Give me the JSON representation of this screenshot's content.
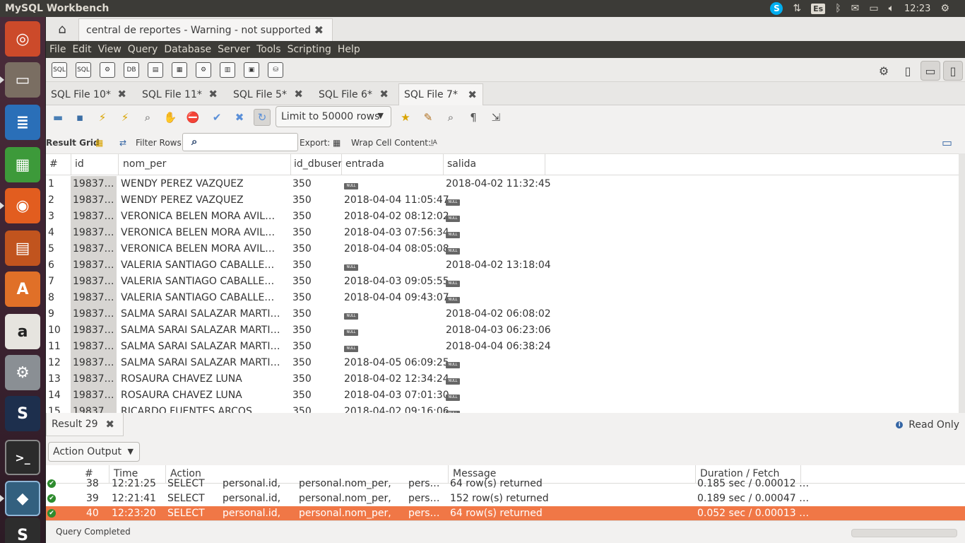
{
  "app": {
    "title": "MySQL Workbench"
  },
  "tray": {
    "skype": "S",
    "lang": "Es",
    "time": "12:23"
  },
  "launcher": {
    "items": [
      {
        "name": "ubuntu-dash-icon",
        "color": "#cc4a2a",
        "glyph": "◎"
      },
      {
        "name": "files-icon",
        "color": "#7a6e62",
        "glyph": "▭"
      },
      {
        "name": "writer-icon",
        "color": "#2a6fb8",
        "glyph": "≣"
      },
      {
        "name": "calc-icon",
        "color": "#3d9a3a",
        "glyph": "▦"
      },
      {
        "name": "firefox-icon",
        "color": "#e25d1f",
        "glyph": "◉"
      },
      {
        "name": "impress-icon",
        "color": "#c1541e",
        "glyph": "▤"
      },
      {
        "name": "software-center-icon",
        "color": "#e07028",
        "glyph": "A"
      },
      {
        "name": "amazon-icon",
        "color": "#e6e4df",
        "glyph": "a"
      },
      {
        "name": "settings-icon",
        "color": "#8a8f94",
        "glyph": "⚙"
      },
      {
        "name": "app-s-icon",
        "color": "#1d2f4d",
        "glyph": "S"
      },
      {
        "name": "terminal-icon",
        "color": "#2b2b2b",
        "glyph": ">_"
      },
      {
        "name": "mysql-workbench-icon",
        "color": "#33607f",
        "glyph": "◆"
      },
      {
        "name": "sublime-icon",
        "color": "#2d2d2d",
        "glyph": "S"
      }
    ]
  },
  "connection_tab": {
    "label": "central de reportes - Warning - not supported"
  },
  "menu": [
    "File",
    "Edit",
    "View",
    "Query",
    "Database",
    "Server",
    "Tools",
    "Scripting",
    "Help"
  ],
  "main_toolbar": {
    "icons": [
      "SQL",
      "SQL",
      "⚙",
      "DB",
      "▤",
      "▦",
      "⚙",
      "▥",
      "▣",
      "⛁"
    ]
  },
  "file_tabs": [
    {
      "label": "SQL File 10*",
      "active": false
    },
    {
      "label": "SQL File 11*",
      "active": false
    },
    {
      "label": "SQL File 5*",
      "active": false
    },
    {
      "label": "SQL File 6*",
      "active": false
    },
    {
      "label": "SQL File 7*",
      "active": true
    }
  ],
  "sql_toolbar": {
    "limit_label": "Limit to 50000 rows"
  },
  "result_bar": {
    "result_grid_label": "Result Grid",
    "filter_label": "Filter Rows:",
    "export_label": "Export:",
    "wrap_label": "Wrap Cell Content:"
  },
  "grid": {
    "columns": [
      "#",
      "id",
      "nom_per",
      "id_dbuser",
      "entrada",
      "salida"
    ],
    "rows": [
      {
        "n": "1",
        "id": "19837…",
        "nom": "WENDY PEREZ VAZQUEZ",
        "db": "350",
        "entrada": null,
        "salida": "2018-04-02 11:32:45"
      },
      {
        "n": "2",
        "id": "19837…",
        "nom": "WENDY PEREZ VAZQUEZ",
        "db": "350",
        "entrada": "2018-04-04 11:05:47",
        "salida": null
      },
      {
        "n": "3",
        "id": "19837…",
        "nom": "VERONICA BELEN MORA AVIL…",
        "db": "350",
        "entrada": "2018-04-02 08:12:02",
        "salida": null
      },
      {
        "n": "4",
        "id": "19837…",
        "nom": "VERONICA BELEN MORA AVIL…",
        "db": "350",
        "entrada": "2018-04-03 07:56:34",
        "salida": null
      },
      {
        "n": "5",
        "id": "19837…",
        "nom": "VERONICA BELEN MORA AVIL…",
        "db": "350",
        "entrada": "2018-04-04 08:05:08",
        "salida": null
      },
      {
        "n": "6",
        "id": "19837…",
        "nom": "VALERIA SANTIAGO CABALLE…",
        "db": "350",
        "entrada": null,
        "salida": "2018-04-02 13:18:04"
      },
      {
        "n": "7",
        "id": "19837…",
        "nom": "VALERIA SANTIAGO CABALLE…",
        "db": "350",
        "entrada": "2018-04-03 09:05:55",
        "salida": null
      },
      {
        "n": "8",
        "id": "19837…",
        "nom": "VALERIA SANTIAGO CABALLE…",
        "db": "350",
        "entrada": "2018-04-04 09:43:07",
        "salida": null
      },
      {
        "n": "9",
        "id": "19837…",
        "nom": "SALMA SARAI SALAZAR MARTI…",
        "db": "350",
        "entrada": null,
        "salida": "2018-04-02 06:08:02"
      },
      {
        "n": "10",
        "id": "19837…",
        "nom": "SALMA SARAI SALAZAR MARTI…",
        "db": "350",
        "entrada": null,
        "salida": "2018-04-03 06:23:06"
      },
      {
        "n": "11",
        "id": "19837…",
        "nom": "SALMA SARAI SALAZAR MARTI…",
        "db": "350",
        "entrada": null,
        "salida": "2018-04-04 06:38:24"
      },
      {
        "n": "12",
        "id": "19837…",
        "nom": "SALMA SARAI SALAZAR MARTI…",
        "db": "350",
        "entrada": "2018-04-05 06:09:25",
        "salida": null
      },
      {
        "n": "13",
        "id": "19837…",
        "nom": "ROSAURA CHAVEZ LUNA",
        "db": "350",
        "entrada": "2018-04-02 12:34:24",
        "salida": null
      },
      {
        "n": "14",
        "id": "19837…",
        "nom": "ROSAURA CHAVEZ LUNA",
        "db": "350",
        "entrada": "2018-04-03 07:01:30",
        "salida": null
      },
      {
        "n": "15",
        "id": "19837…",
        "nom": "RICARDO FUENTES ARCOS",
        "db": "350",
        "entrada": "2018-04-02 09:16:06",
        "salida": null
      }
    ],
    "null_label": "NULL"
  },
  "result_tab": {
    "label": "Result 29"
  },
  "read_only": {
    "label": "Read Only"
  },
  "output": {
    "select_label": "Action Output",
    "columns": [
      "#",
      "Time",
      "Action",
      "Message",
      "Duration / Fetch"
    ],
    "rows": [
      {
        "n": "38",
        "time": "12:21:25",
        "a1": "SELECT",
        "a2": "personal.id,",
        "a3": "personal.nom_per,",
        "a4": "pers…",
        "msg": "64 row(s) returned",
        "dur": "0.185 sec / 0.00012 …",
        "selected": false
      },
      {
        "n": "39",
        "time": "12:21:41",
        "a1": "SELECT",
        "a2": "personal.id,",
        "a3": "personal.nom_per,",
        "a4": "pers…",
        "msg": "152 row(s) returned",
        "dur": "0.189 sec / 0.00047 …",
        "selected": false
      },
      {
        "n": "40",
        "time": "12:23:20",
        "a1": "SELECT",
        "a2": "personal.id,",
        "a3": "personal.nom_per,",
        "a4": "pers…",
        "msg": "64 row(s) returned",
        "dur": "0.052 sec / 0.00013 …",
        "selected": true
      }
    ]
  },
  "status": {
    "text": "Query Completed"
  },
  "colors": {
    "selection": "#f07746",
    "panel": "#3c3b37",
    "ok": "#2e8b2e"
  }
}
